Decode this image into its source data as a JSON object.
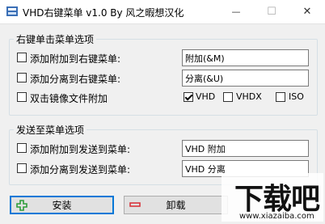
{
  "window": {
    "title": "VHD右键菜单 v1.0 By 风之暇想汉化",
    "minimize_glyph": "—",
    "maximize_glyph": "☐",
    "close_glyph": "✕"
  },
  "group_context": {
    "legend": "右键单击菜单选项",
    "rows": [
      {
        "label": "添加附加到右键菜单:",
        "checked": false,
        "value": "附加(&M)"
      },
      {
        "label": "添加分离到右键菜单:",
        "checked": false,
        "value": "分离(&U)"
      }
    ],
    "mount_row": {
      "label": "双击镜像文件附加",
      "checked": false,
      "options": [
        {
          "label": "VHD",
          "checked": true
        },
        {
          "label": "VHDX",
          "checked": false
        },
        {
          "label": "ISO",
          "checked": false
        }
      ]
    }
  },
  "group_sendto": {
    "legend": "发送至菜单选项",
    "rows": [
      {
        "label": "添加附加到发送到菜单:",
        "checked": false,
        "value": "VHD 附加"
      },
      {
        "label": "添加分离到发送到菜单:",
        "checked": false,
        "value": "VHD 分离"
      }
    ]
  },
  "buttons": {
    "install": "安装",
    "uninstall": "卸载"
  },
  "watermark": {
    "text": "下载吧",
    "url": "www.xiazaiba.com"
  },
  "colors": {
    "install_icon": "#2e9d3a",
    "uninstall_icon": "#d9363e",
    "focus_border": "#0078d7"
  }
}
